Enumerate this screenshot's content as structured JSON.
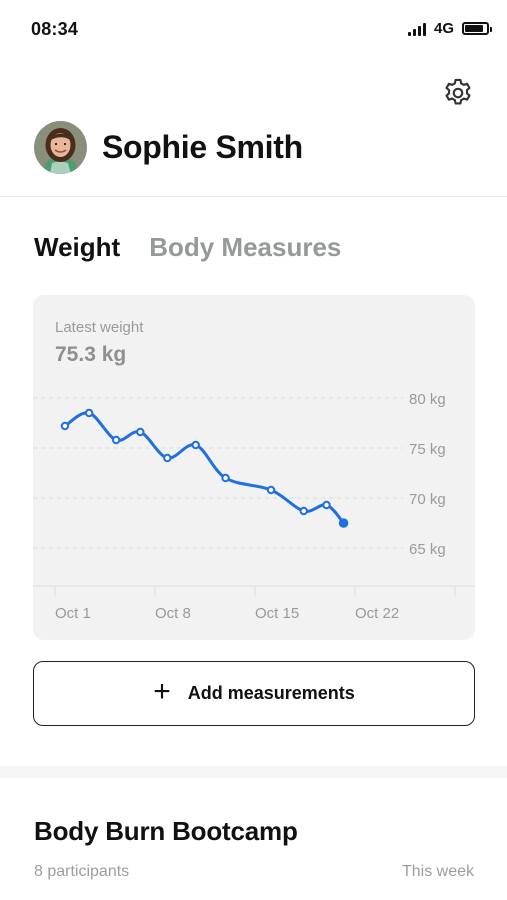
{
  "status_bar": {
    "time": "08:34",
    "network": "4G",
    "signal_icon": "cellular-signal-icon",
    "battery_icon": "battery-icon",
    "battery_level": 0.85
  },
  "header": {
    "settings_icon": "gear-icon",
    "avatar_icon": "user-avatar-photo",
    "user_name": "Sophie Smith"
  },
  "tabs": [
    {
      "label": "Weight",
      "active": true
    },
    {
      "label": "Body Measures",
      "active": false
    }
  ],
  "weight_card": {
    "latest_label": "Latest weight",
    "latest_value": "75.3 kg"
  },
  "chart_data": {
    "type": "line",
    "title": "",
    "xlabel": "",
    "ylabel": "",
    "x_ticks": [
      "Oct 1",
      "Oct 8",
      "Oct 15",
      "Oct 22"
    ],
    "y_ticks": [
      "80 kg",
      "75 kg",
      "70 kg",
      "65 kg"
    ],
    "ylim": [
      62,
      85
    ],
    "xlim": [
      0,
      28
    ],
    "grid": true,
    "series": [
      {
        "x": [
          0.7,
          2.4,
          4.3,
          6.0,
          7.9,
          9.9,
          12.0,
          15.2,
          17.5,
          19.1
        ],
        "y": [
          77.2,
          78.5,
          75.8,
          76.6,
          74.0,
          75.3,
          72.0,
          70.8,
          68.7,
          69.3
        ],
        "end_point": {
          "x": 20.3,
          "y": 67.5
        },
        "color": "#1f6fe0"
      }
    ]
  },
  "add_button": {
    "icon": "plus-icon",
    "plus_glyph": "+",
    "label": "Add measurements"
  },
  "program": {
    "title": "Body Burn Bootcamp",
    "participants": "8 participants",
    "period": "This week"
  }
}
